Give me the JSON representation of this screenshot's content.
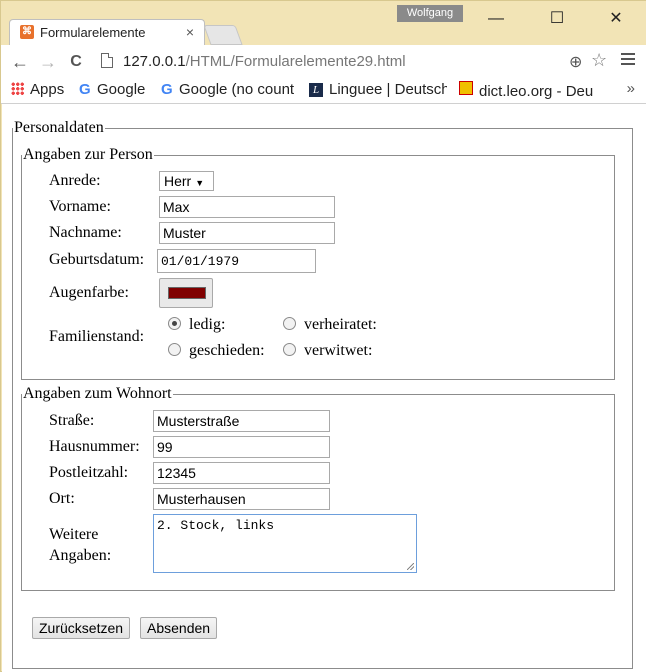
{
  "window": {
    "user": "Wolfgang",
    "controls": {
      "minimize": "—",
      "maximize": "☐",
      "close": "✕"
    }
  },
  "tab": {
    "title": "Formularelemente",
    "close": "×"
  },
  "toolbar": {
    "back": "←",
    "forward": "→",
    "reload": "C",
    "url_host": "127.0.0.1",
    "url_path": "/HTML/Formularelemente29.html",
    "zoom": "⊕",
    "star": "☆"
  },
  "bookmarks": {
    "items": [
      "Apps",
      "Google",
      "Google (no count",
      "Linguee | Deutsch",
      "dict.leo.org - Deu"
    ],
    "more": "»"
  },
  "form": {
    "outer_legend": "Personaldaten",
    "person": {
      "legend": "Angaben zur Person",
      "anrede_label": "Anrede:",
      "anrede_value": "Herr",
      "caret": "▼",
      "vorname_label": "Vorname:",
      "vorname_value": "Max",
      "nachname_label": "Nachname:",
      "nachname_value": "Muster",
      "geburtsdatum_label": "Geburtsdatum:",
      "geburtsdatum_value": "01/01/1979",
      "augenfarbe_label": "Augenfarbe:",
      "augenfarbe_color": "#800000",
      "familienstand_label": "Familienstand:",
      "options": [
        {
          "label": "ledig:",
          "checked": true
        },
        {
          "label": "verheiratet:",
          "checked": false
        },
        {
          "label": "geschieden:",
          "checked": false
        },
        {
          "label": "verwitwet:",
          "checked": false
        }
      ]
    },
    "wohnort": {
      "legend": "Angaben zum Wohnort",
      "strasse_label": "Straße:",
      "strasse_value": "Musterstraße",
      "hausnummer_label": "Hausnummer:",
      "hausnummer_value": "99",
      "plz_label": "Postleitzahl:",
      "plz_value": "12345",
      "ort_label": "Ort:",
      "ort_value": "Musterhausen",
      "weitere_label_1": "Weitere",
      "weitere_label_2": "Angaben:",
      "weitere_value": "2. Stock, links"
    },
    "buttons": {
      "reset": "Zurücksetzen",
      "submit": "Absenden"
    }
  }
}
